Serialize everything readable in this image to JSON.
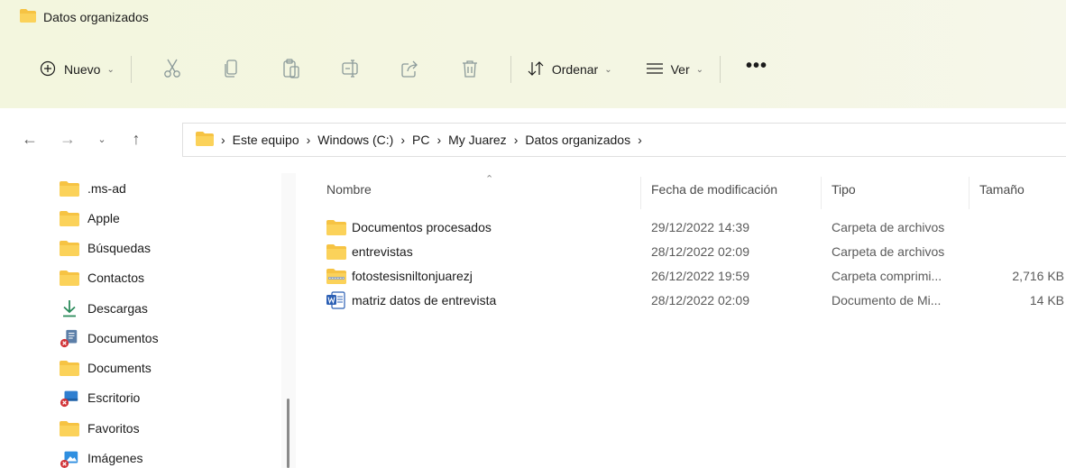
{
  "window": {
    "title": "Datos organizados"
  },
  "toolbar": {
    "new_label": "Nuevo",
    "sort_label": "Ordenar",
    "view_label": "Ver",
    "more_label": "•••",
    "icons": [
      "cut-icon",
      "copy-icon",
      "paste-icon",
      "rename-icon",
      "share-icon",
      "delete-icon"
    ]
  },
  "nav": {
    "back": "←",
    "forward": "→",
    "recent": "⌄",
    "up": "↑"
  },
  "breadcrumb": {
    "items": [
      "Este equipo",
      "Windows (C:)",
      "PC",
      "My Juarez",
      "Datos organizados"
    ],
    "separator": "›"
  },
  "sidebar": {
    "items": [
      {
        "label": ".ms-ad",
        "icon": "folder-icon"
      },
      {
        "label": "Apple",
        "icon": "folder-icon"
      },
      {
        "label": "Búsquedas",
        "icon": "folder-icon"
      },
      {
        "label": "Contactos",
        "icon": "folder-icon"
      },
      {
        "label": "Descargas",
        "icon": "download-icon"
      },
      {
        "label": "Documentos",
        "icon": "documents-icon"
      },
      {
        "label": "Documents",
        "icon": "folder-icon"
      },
      {
        "label": "Escritorio",
        "icon": "desktop-icon"
      },
      {
        "label": "Favoritos",
        "icon": "folder-icon"
      },
      {
        "label": "Imágenes",
        "icon": "pictures-icon"
      }
    ]
  },
  "list": {
    "columns": {
      "name": "Nombre",
      "date": "Fecha de modificación",
      "type": "Tipo",
      "size": "Tamaño"
    },
    "sort_indicator": "⌃",
    "rows": [
      {
        "name": "Documentos procesados",
        "date": "29/12/2022 14:39",
        "type": "Carpeta de archivos",
        "size": "",
        "icon": "folder-icon"
      },
      {
        "name": "entrevistas",
        "date": "28/12/2022 02:09",
        "type": "Carpeta de archivos",
        "size": "",
        "icon": "folder-icon"
      },
      {
        "name": "fotostesisniltonjuarezj",
        "date": "26/12/2022 19:59",
        "type": "Carpeta comprimi...",
        "size": "2,716 KB",
        "icon": "zip-folder-icon"
      },
      {
        "name": "matriz datos de entrevista",
        "date": "28/12/2022 02:09",
        "type": "Documento de Mi...",
        "size": "14 KB",
        "icon": "word-document-icon"
      }
    ]
  },
  "colors": {
    "folder": "#f6c343",
    "header_bg": "#f3f6de",
    "error_badge": "#d13438",
    "word_blue": "#2b5fb4"
  }
}
